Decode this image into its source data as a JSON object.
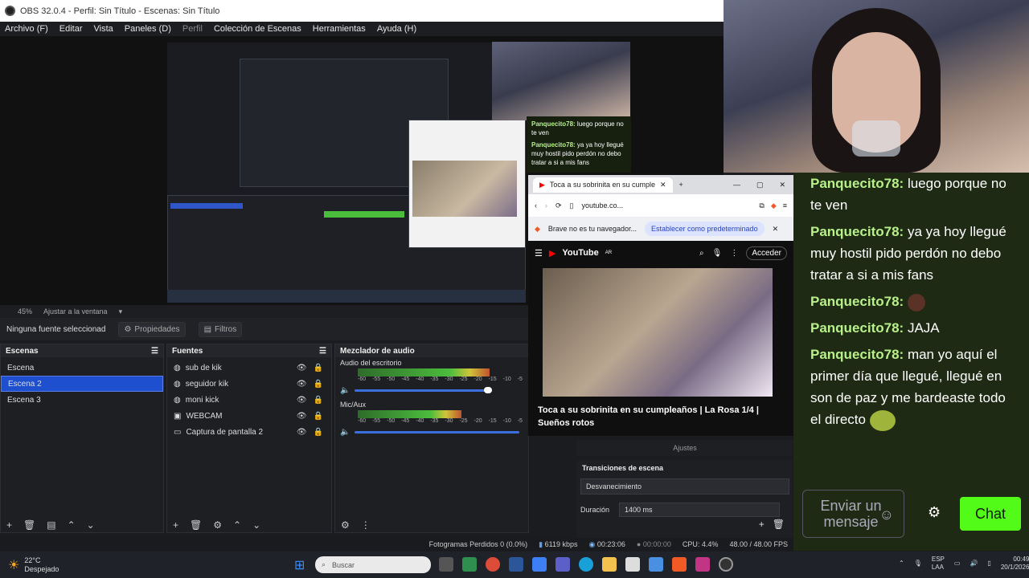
{
  "window": {
    "title": "OBS 32.0.4 - Perfil: Sin Título - Escenas: Sin Título"
  },
  "menu": [
    "Archivo (F)",
    "Editar",
    "Vista",
    "Paneles (D)",
    "Perfil",
    "Colección de Escenas",
    "Herramientas",
    "Ayuda (H)"
  ],
  "zoom": {
    "percent": "45%",
    "fit_label": "Ajustar a la ventana"
  },
  "props": {
    "no_source": "Ninguna fuente seleccionad",
    "properties": "Propiedades",
    "filters": "Filtros"
  },
  "scenes": {
    "title": "Escenas",
    "items": [
      "Escena",
      "Escena 2",
      "Escena 3"
    ],
    "selected": 1
  },
  "sources": {
    "title": "Fuentes",
    "items": [
      "sub de kik",
      "seguidor kik",
      "moni kick",
      "WEBCAM",
      "Captura de pantalla 2"
    ]
  },
  "mixer": {
    "title": "Mezclador de audio",
    "channels": [
      {
        "name": "Audio del escritorio",
        "level": 0.8,
        "volume": 0.83
      },
      {
        "name": "Mic/Aux",
        "level": 0.63,
        "volume": 1.0
      }
    ],
    "ticks": [
      "-60",
      "-55",
      "-50",
      "-45",
      "-40",
      "-35",
      "-30",
      "-25",
      "-20",
      "-15",
      "-10",
      "-5"
    ]
  },
  "transitions": {
    "section": "Ajustes",
    "title": "Transiciones de escena",
    "type": "Desvanecimiento",
    "duration_label": "Duración",
    "duration_value": "1400 ms"
  },
  "status": {
    "dropped": "Fotogramas Perdidos 0 (0.0%)",
    "bitrate": "6119 kbps",
    "stream_time": "00:23:06",
    "rec_time": "00:00:00",
    "cpu": "CPU: 4.4%",
    "fps": "48.00 / 48.00 FPS"
  },
  "browser": {
    "tab_title": "Toca a su sobrinita en su cumple",
    "url": "youtube.co...",
    "notice": "Brave no es tu navegador...",
    "notice_button": "Establecer como predeterminado",
    "yt_logo": "YouTube",
    "yt_country": "AR",
    "signin": "Acceder",
    "video_title": "Toca a su sobrinita en su cumpleaños | La Rosa 1/4 | Sueños rotos"
  },
  "chat": {
    "messages": [
      {
        "user": "Panquecito78:",
        "text": "luego porque no te ven"
      },
      {
        "user": "Panquecito78:",
        "text": "ya ya hoy llegué muy hostil pido perdón no debo tratar a si a mis fans"
      },
      {
        "user": "Panquecito78:",
        "text": ""
      },
      {
        "user": "Panquecito78:",
        "text": "JAJA"
      },
      {
        "user": "Panquecito78:",
        "text": "man yo aquí el primer día que llegué, llegué en son de paz y me bardeaste todo el directo"
      }
    ],
    "input_placeholder": "Enviar un mensaje",
    "chat_button": "Chat",
    "accent": "#53fc18"
  },
  "preview_chat": [
    {
      "user": "Panquecito78:",
      "text": "luego porque no te ven"
    },
    {
      "user": "Panquecito78:",
      "text": "ya ya hoy llegué muy hostil pido perdón no debo tratar a si a mis fans"
    }
  ],
  "taskbar": {
    "weather_temp": "22°C",
    "weather_desc": "Despejado",
    "search": "Buscar",
    "lang1": "ESP",
    "lang2": "LAA",
    "time": "00:49",
    "date": "20/1/2026"
  }
}
